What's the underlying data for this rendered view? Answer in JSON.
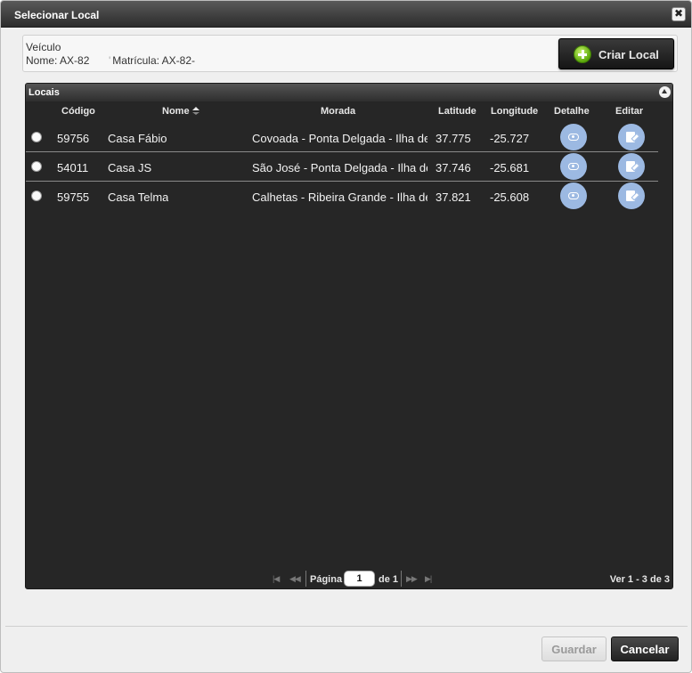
{
  "dialog": {
    "title": "Selecionar Local"
  },
  "vehicle": {
    "label": "Veículo",
    "name": "Nome: AX-82",
    "plate": "Matrícula: AX-82-"
  },
  "actions": {
    "criar_local": "Criar Local"
  },
  "panel": {
    "title": "Locais"
  },
  "table": {
    "headers": {
      "codigo": "Código",
      "nome": "Nome",
      "morada": "Morada",
      "latitude": "Latitude",
      "longitude": "Longitude",
      "detalhe": "Detalhe",
      "editar": "Editar"
    },
    "rows": [
      {
        "codigo": "59756",
        "nome": "Casa Fábio",
        "morada": "Covoada - Ponta Delgada - Ilha de",
        "latitude": "37.775",
        "longitude": "-25.727"
      },
      {
        "codigo": "54011",
        "nome": "Casa JS",
        "morada": "São José - Ponta Delgada - Ilha de",
        "latitude": "37.746",
        "longitude": "-25.681"
      },
      {
        "codigo": "59755",
        "nome": "Casa Telma",
        "morada": "Calhetas - Ribeira Grande - Ilha de",
        "latitude": "37.821",
        "longitude": "-25.608"
      }
    ]
  },
  "pager": {
    "page_label": "Página",
    "page_value": "1",
    "of_label": "de 1",
    "info": "Ver 1 - 3 de 3"
  },
  "footer": {
    "guardar": "Guardar",
    "cancelar": "Cancelar"
  }
}
